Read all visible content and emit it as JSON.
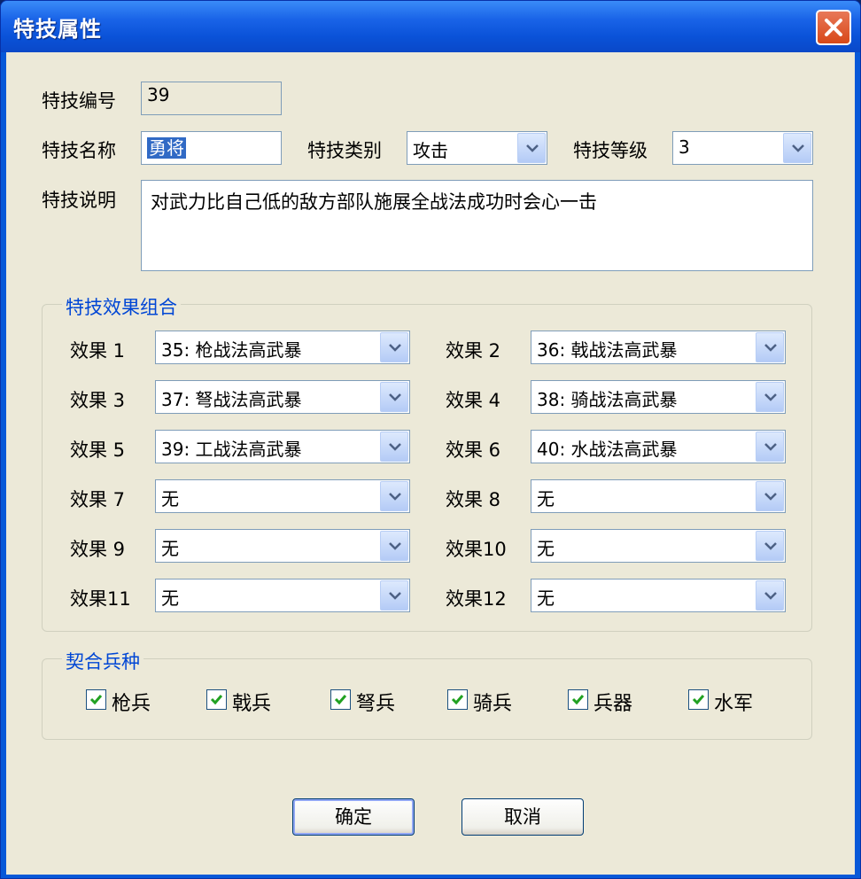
{
  "window": {
    "title": "特技属性"
  },
  "fields": {
    "id_label": "特技编号",
    "id_value": "39",
    "name_label": "特技名称",
    "name_value": "勇将",
    "category_label": "特技类别",
    "category_value": "攻击",
    "level_label": "特技等级",
    "level_value": "3",
    "desc_label": "特技说明",
    "desc_value": "对武力比自己低的敌方部队施展全战法成功时会心一击"
  },
  "effects_group": {
    "title": "特技效果组合",
    "items": [
      {
        "label": "效果 1",
        "value": "35: 枪战法高武暴"
      },
      {
        "label": "效果 2",
        "value": "36: 戟战法高武暴"
      },
      {
        "label": "效果 3",
        "value": "37: 弩战法高武暴"
      },
      {
        "label": "效果 4",
        "value": "38: 骑战法高武暴"
      },
      {
        "label": "效果 5",
        "value": "39: 工战法高武暴"
      },
      {
        "label": "效果 6",
        "value": "40: 水战法高武暴"
      },
      {
        "label": "效果 7",
        "value": "无"
      },
      {
        "label": "效果 8",
        "value": "无"
      },
      {
        "label": "效果 9",
        "value": "无"
      },
      {
        "label": "效果10",
        "value": "无"
      },
      {
        "label": "效果11",
        "value": "无"
      },
      {
        "label": "效果12",
        "value": "无"
      }
    ]
  },
  "troops_group": {
    "title": "契合兵种",
    "items": [
      {
        "label": "枪兵",
        "checked": true
      },
      {
        "label": "戟兵",
        "checked": true
      },
      {
        "label": "弩兵",
        "checked": true
      },
      {
        "label": "骑兵",
        "checked": true
      },
      {
        "label": "兵器",
        "checked": true
      },
      {
        "label": "水军",
        "checked": true
      }
    ]
  },
  "buttons": {
    "ok": "确定",
    "cancel": "取消"
  },
  "icons": {
    "close": "close-icon",
    "dropdown": "chevron-down-icon",
    "check": "checkmark-icon"
  },
  "colors": {
    "titlebar": "#0a52d8",
    "close": "#d84818",
    "client": "#ece9d8",
    "selection": "#316ac5",
    "group_title": "#0046d5"
  }
}
